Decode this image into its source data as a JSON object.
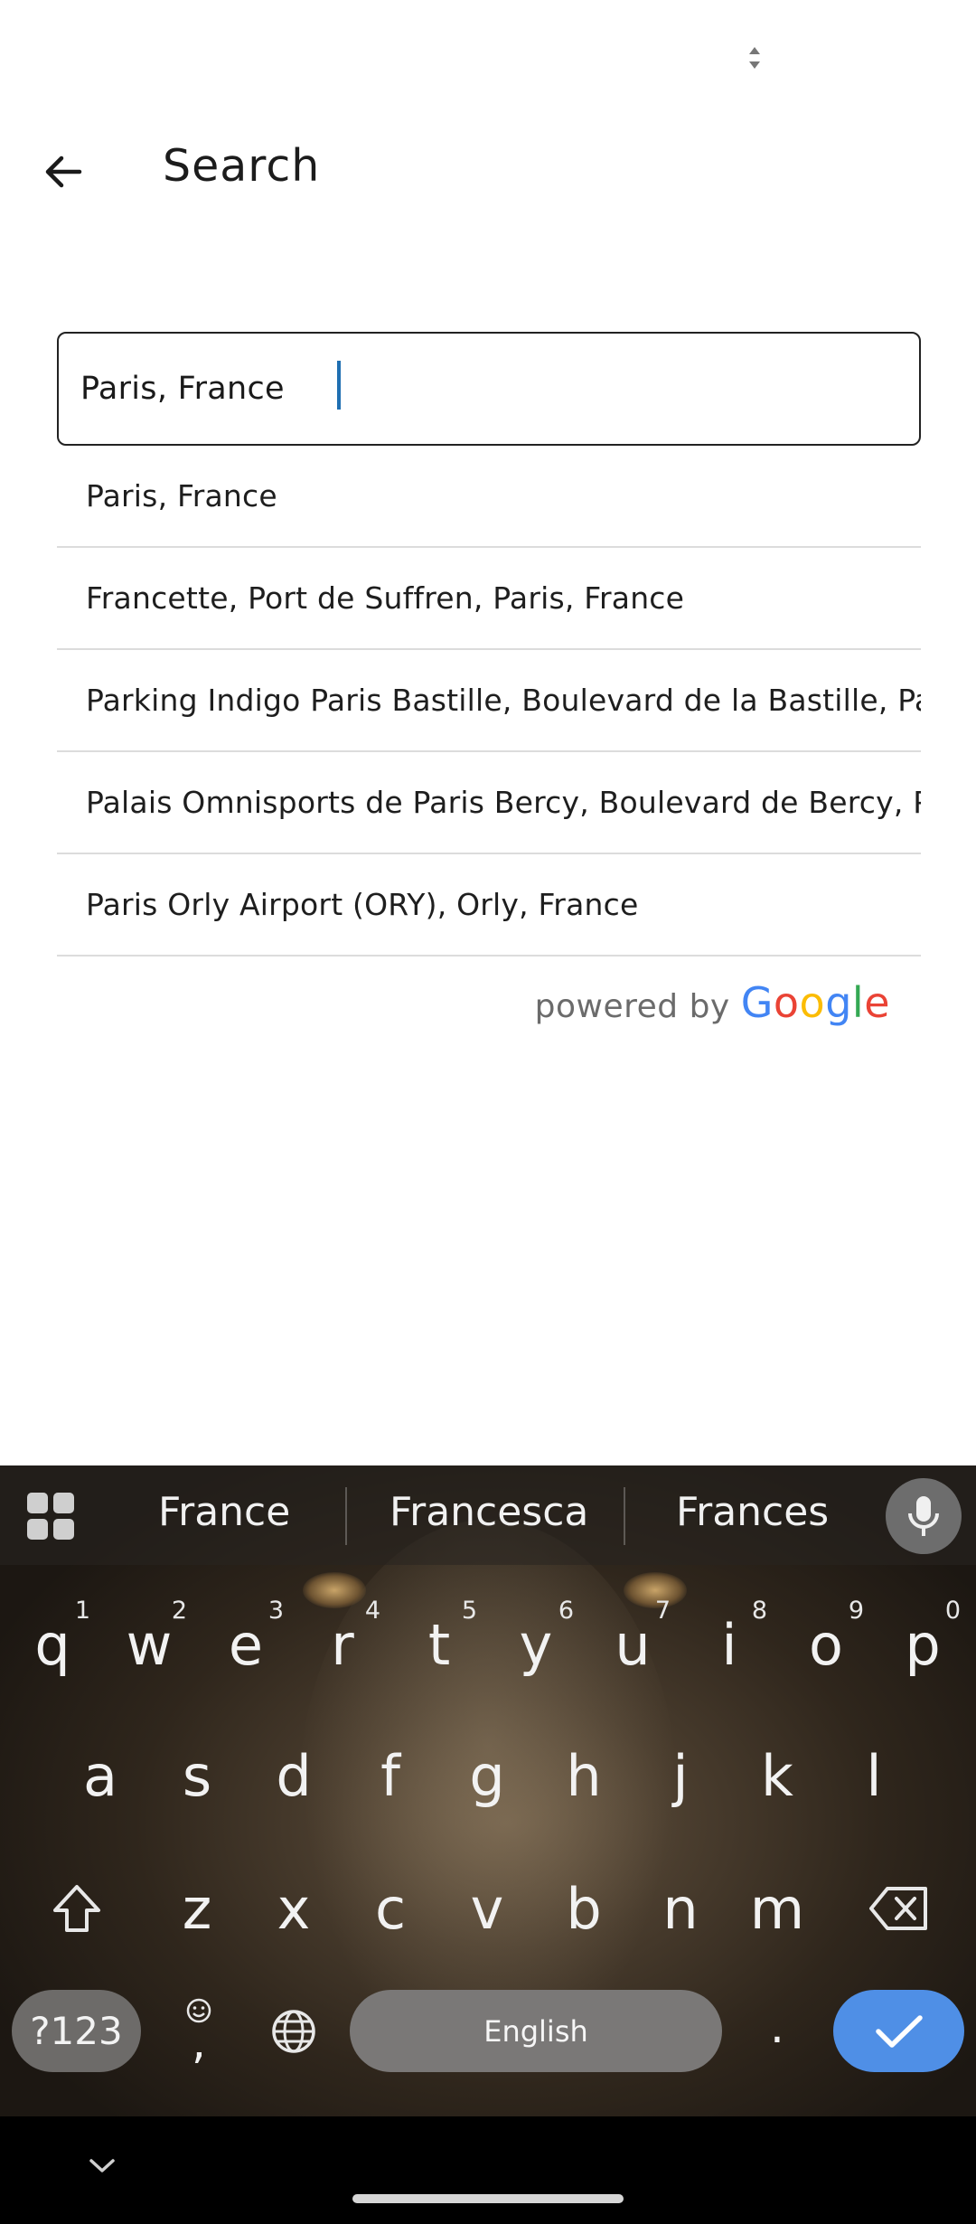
{
  "app_bar": {
    "title": "Search",
    "back_icon": "arrow-left-icon"
  },
  "search": {
    "value": "Paris, France",
    "placeholder": ""
  },
  "suggestions": [
    {
      "label": "Paris, France"
    },
    {
      "label": "Francette, Port de Suffren, Paris, France"
    },
    {
      "label": "Parking Indigo Paris Bastille, Boulevard de la Bastille, Paris, France"
    },
    {
      "label": "Palais Omnisports de Paris Bercy, Boulevard de Bercy, Paris, France"
    },
    {
      "label": "Paris Orly Airport (ORY), Orly, France"
    }
  ],
  "attribution": {
    "prefix": "powered by",
    "brand": "Google",
    "brand_colors": [
      "#4285F4",
      "#EA4335",
      "#FBBC05",
      "#4285F4",
      "#34A853",
      "#EA4335"
    ]
  },
  "keyboard": {
    "suggestions": [
      "France",
      "Francesca",
      "Frances"
    ],
    "row1": [
      {
        "ch": "q",
        "num": "1"
      },
      {
        "ch": "w",
        "num": "2"
      },
      {
        "ch": "e",
        "num": "3"
      },
      {
        "ch": "r",
        "num": "4"
      },
      {
        "ch": "t",
        "num": "5"
      },
      {
        "ch": "y",
        "num": "6"
      },
      {
        "ch": "u",
        "num": "7"
      },
      {
        "ch": "i",
        "num": "8"
      },
      {
        "ch": "o",
        "num": "9"
      },
      {
        "ch": "p",
        "num": "0"
      }
    ],
    "row2": [
      "a",
      "s",
      "d",
      "f",
      "g",
      "h",
      "j",
      "k",
      "l"
    ],
    "row3": [
      "z",
      "x",
      "c",
      "v",
      "b",
      "n",
      "m"
    ],
    "symbols_label": "?123",
    "comma": ",",
    "period": ".",
    "space_label": "English",
    "accent_color": "#4f8fe6"
  }
}
